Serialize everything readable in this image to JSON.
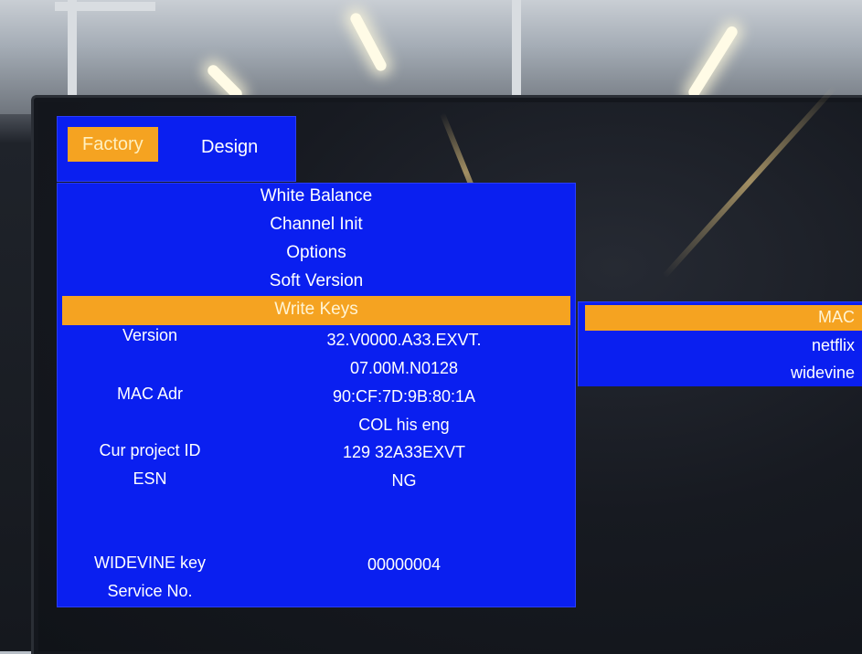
{
  "tabs": [
    {
      "label": "Factory",
      "active": true
    },
    {
      "label": "Design",
      "active": false
    }
  ],
  "menu": {
    "items": [
      "White Balance",
      "Channel Init",
      "Options",
      "Soft Version"
    ],
    "selected": "Write Keys"
  },
  "info": {
    "version_label": "Version",
    "version_value_1": "32.V0000.A33.EXVT.",
    "version_value_2": "07.00M.N0128",
    "mac_label": "MAC Adr",
    "mac_value": "90:CF:7D:9B:80:1A",
    "col_value": "COL his eng",
    "project_label": "Cur project ID",
    "project_value": "129 32A33EXVT",
    "esn_label": "ESN",
    "esn_value": "NG",
    "widevine_label": "WIDEVINE key",
    "widevine_value": "00000004",
    "service_label": "Service No."
  },
  "submenu": {
    "items": [
      "MAC",
      "netflix",
      "widevine"
    ],
    "selected_index": 0
  },
  "colors": {
    "osd_blue": "#0a1ff0",
    "highlight": "#f5a321",
    "text": "#ffffff"
  }
}
